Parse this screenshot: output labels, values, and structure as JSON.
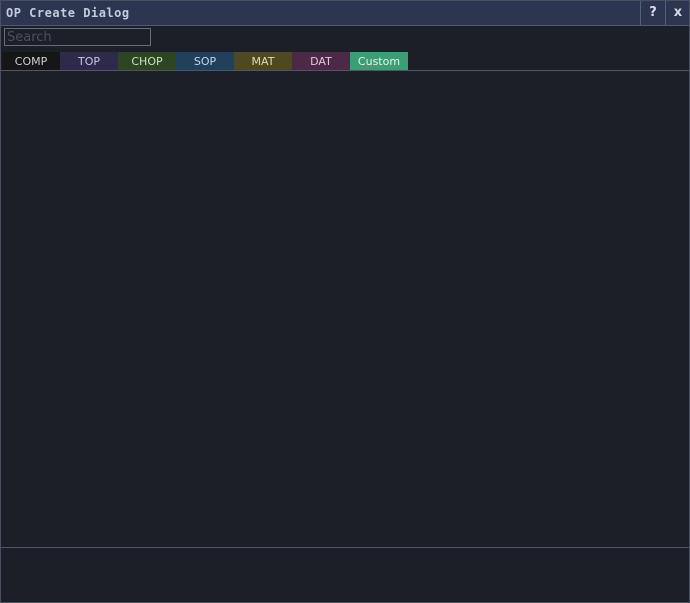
{
  "window": {
    "title": "OP Create Dialog",
    "help_label": "?",
    "close_label": "x"
  },
  "search": {
    "placeholder": "Search",
    "value": ""
  },
  "tabs": [
    {
      "label": "COMP",
      "color": "#161616",
      "text_color": "#d0d0d0"
    },
    {
      "label": "TOP",
      "color": "#2e2a4c",
      "text_color": "#c9c6e0"
    },
    {
      "label": "CHOP",
      "color": "#2d4622",
      "text_color": "#cde0c0"
    },
    {
      "label": "SOP",
      "color": "#21405c",
      "text_color": "#c3d6e8"
    },
    {
      "label": "MAT",
      "color": "#4e4920",
      "text_color": "#e0dcb4"
    },
    {
      "label": "DAT",
      "color": "#4c2a47",
      "text_color": "#e0c8dc"
    },
    {
      "label": "Custom",
      "color": "#3c9e72",
      "text_color": "#e6f4ec"
    }
  ]
}
